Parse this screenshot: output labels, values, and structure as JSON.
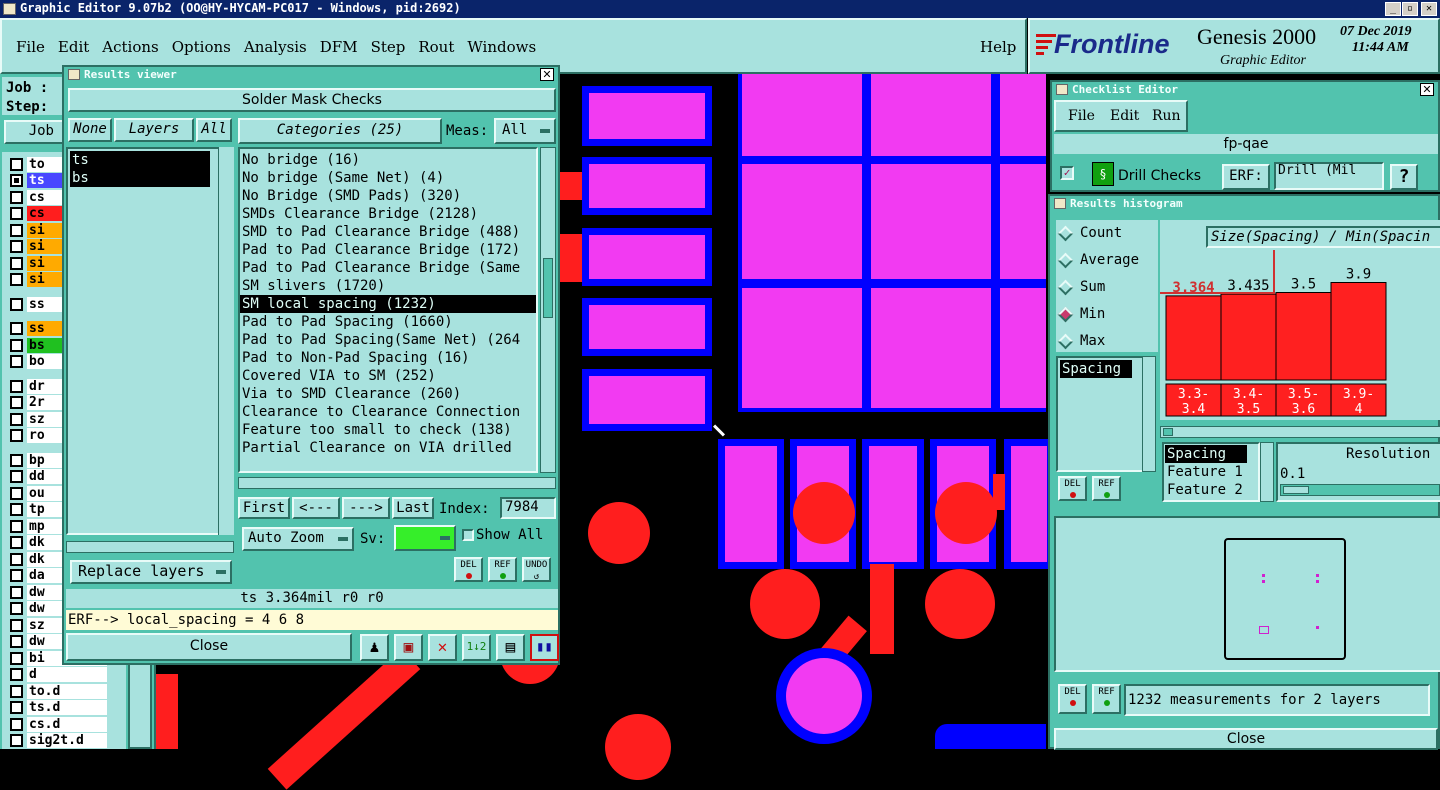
{
  "title_bar": {
    "title": "Graphic Editor 9.07b2 (OO@HY-HYCAM-PC017 - Windows, pid:2692)",
    "controls": [
      "_",
      "▫",
      "✕"
    ]
  },
  "menu": {
    "items": [
      "File",
      "Edit",
      "Actions",
      "Options",
      "Analysis",
      "DFM",
      "Step",
      "Rout",
      "Windows"
    ],
    "help": "Help"
  },
  "branding": {
    "logo": "Frontline",
    "product": "Genesis 2000",
    "subtitle": "Graphic Editor",
    "date": "07 Dec 2019",
    "time": "11:44 AM"
  },
  "left_panel": {
    "job_label": "Job :",
    "step_label": "Step:",
    "job_matrix_label": "Job Ma",
    "layers": [
      "to",
      "ts",
      "cs",
      "cs",
      "si",
      "si",
      "si",
      "si",
      "ss",
      "ss",
      "bs",
      "bo",
      "dr",
      "2r",
      "sz",
      "ro",
      "bp",
      "dd",
      "ou",
      "tp",
      "mp",
      "dk",
      "dk",
      "da",
      "dw",
      "dw",
      "sz",
      "dw",
      "bi",
      "d",
      "to.d",
      "ts.d",
      "cs.d",
      "sig2t.d"
    ]
  },
  "results_viewer": {
    "title": "Results viewer",
    "header": "Solder Mask Checks",
    "none_btn": "None",
    "layers_btn": "Layers",
    "all_btn": "All",
    "categories_btn": "Categories (25)",
    "meas_label": "Meas:",
    "meas_value": "All",
    "layers": [
      "ts",
      "bs"
    ],
    "categories": [
      "No bridge (16)",
      "No bridge (Same Net) (4)",
      "No Bridge (SMD Pads) (320)",
      "SMDs Clearance Bridge (2128)",
      "SMD to Pad Clearance Bridge (488)",
      "Pad to Pad Clearance Bridge (172)",
      "Pad to Pad Clearance Bridge (Same",
      "SM slivers (1720)",
      "SM local spacing (1232)",
      "Pad to Pad Spacing (1660)",
      "Pad to Pad Spacing(Same Net) (264",
      "Pad to Non-Pad Spacing (16)",
      "Covered VIA to SM (252)",
      "Via to SMD Clearance (260)",
      "Clearance to Clearance Connection",
      "Feature too small to check (138)",
      "Partial Clearance on VIA drilled"
    ],
    "selected_category": "SM local spacing (1232)",
    "first": "First",
    "prev": "<---",
    "next": "--->",
    "last": "Last",
    "index_label": "Index:",
    "index_value": "7984",
    "auto_zoom": "Auto Zoom",
    "sv_label": "Sv:",
    "show_all": "Show All",
    "replace_layers": "Replace layers",
    "status": "ts 3.364mil  r0  r0",
    "erf": "ERF--> local_spacing = 4 6 8",
    "close": "Close",
    "del": "DEL",
    "ref": "REF",
    "undo": "UNDO"
  },
  "checklist_editor": {
    "title": "Checklist Editor",
    "menu": [
      "File",
      "Edit",
      "Run"
    ],
    "name": "fp-qae",
    "item": "Drill Checks",
    "erf_label": "ERF:",
    "erf_value": "Drill (Mil",
    "help": "?"
  },
  "histogram": {
    "title": "Results histogram",
    "options": [
      "Count",
      "Average",
      "Sum",
      "Min",
      "Max"
    ],
    "selected": "Min",
    "chart_title": "Size(Spacing) / Min(Spacin",
    "list": [
      "Spacing"
    ],
    "sort_list": [
      "Spacing",
      "Feature 1",
      "Feature 2"
    ],
    "resolution_label": "Resolution",
    "resolution_value": "0.1",
    "status": "1232 measurements for 2 layers",
    "close": "Close",
    "del": "DEL",
    "ref": "REF"
  },
  "chart_data": {
    "type": "bar",
    "title": "Size(Spacing) / Min(Spacin",
    "categories": [
      "3.3-3.4",
      "3.4-3.5",
      "3.5-3.6",
      "3.9-4"
    ],
    "category_labels": [
      [
        "3.3-",
        "3.4"
      ],
      [
        "3.4-",
        "3.5"
      ],
      [
        "3.5-",
        "3.6"
      ],
      [
        "3.9-",
        "4"
      ]
    ],
    "values": [
      3.364,
      3.435,
      3.5,
      3.9
    ],
    "value_labels": [
      "3.364",
      "3.435",
      "3.5",
      "3.9"
    ],
    "highlight": [
      0,
      1
    ],
    "ylim": [
      0,
      5.2
    ],
    "bar_color": "#ff2020"
  },
  "colors": {
    "teal": "#52c3ae",
    "light": "#a8e2de",
    "pad": "#f23af2",
    "mask": "#0000ff",
    "copper": "#ff1e1e",
    "highlight": "#d03030"
  }
}
